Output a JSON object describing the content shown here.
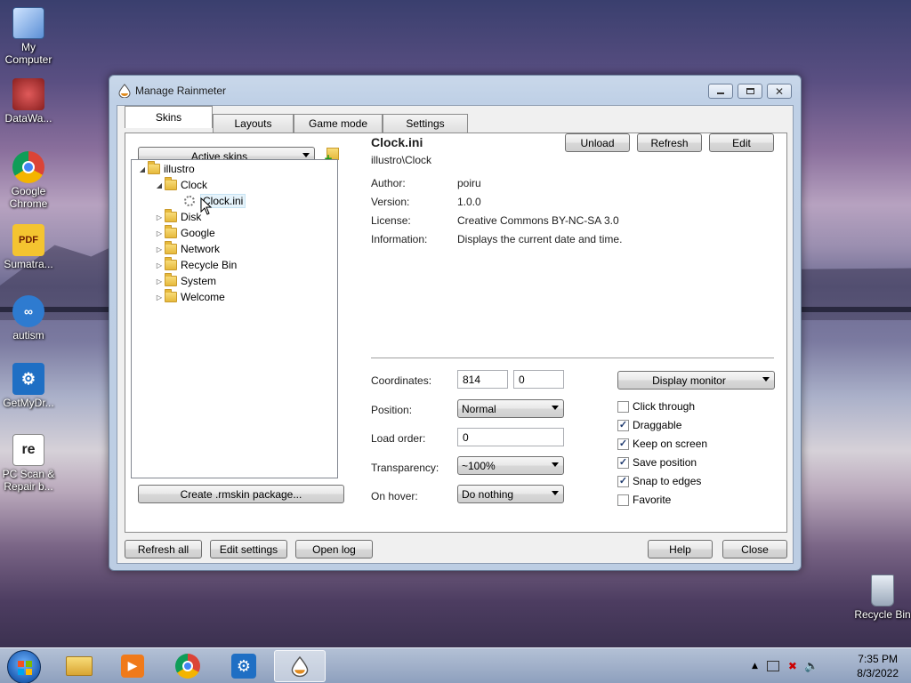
{
  "desktop": {
    "icons": [
      {
        "label": "My Computer",
        "icon": "computer-icon"
      },
      {
        "label": "DataWa...",
        "icon": "app-shortcut-icon"
      },
      {
        "label": "Google Chrome",
        "icon": "chrome-icon"
      },
      {
        "label": "Sumatra...",
        "icon": "pdf-icon"
      },
      {
        "label": "autism",
        "icon": "app-shortcut-icon"
      },
      {
        "label": "GetMyDr...",
        "icon": "gear-app-icon"
      },
      {
        "label": "PC Scan & Repair b...",
        "icon": "repair-icon"
      },
      {
        "label": "Recycle Bin",
        "icon": "recycle-bin-icon"
      }
    ]
  },
  "window": {
    "title": "Manage Rainmeter",
    "tabs": [
      {
        "label": "Skins",
        "active": true
      },
      {
        "label": "Layouts",
        "active": false
      },
      {
        "label": "Game mode",
        "active": false
      },
      {
        "label": "Settings",
        "active": false
      }
    ],
    "skins": {
      "active_skins_label": "Active skins",
      "tree": {
        "root": "illustro",
        "folders": [
          "Clock",
          "Disk",
          "Google",
          "Network",
          "Recycle Bin",
          "System",
          "Welcome"
        ],
        "clock_child": "Clock.ini"
      },
      "create_package_label": "Create .rmskin package...",
      "detail": {
        "name": "Clock.ini",
        "path": "illustro\\Clock",
        "buttons": {
          "unload": "Unload",
          "refresh": "Refresh",
          "edit": "Edit"
        },
        "info": [
          {
            "key": "Author:",
            "value": "poiru"
          },
          {
            "key": "Version:",
            "value": "1.0.0"
          },
          {
            "key": "License:",
            "value": "Creative Commons BY-NC-SA 3.0"
          },
          {
            "key": "Information:",
            "value": "Displays the current date and time."
          }
        ]
      },
      "settings": {
        "coordinates_label": "Coordinates:",
        "coord_x": "814",
        "coord_y": "0",
        "position_label": "Position:",
        "position_value": "Normal",
        "load_order_label": "Load order:",
        "load_order_value": "0",
        "transparency_label": "Transparency:",
        "transparency_value": "~100%",
        "on_hover_label": "On hover:",
        "on_hover_value": "Do nothing",
        "display_monitor_label": "Display monitor",
        "checkboxes": [
          {
            "label": "Click through",
            "checked": false
          },
          {
            "label": "Draggable",
            "checked": true
          },
          {
            "label": "Keep on screen",
            "checked": true
          },
          {
            "label": "Save position",
            "checked": true
          },
          {
            "label": "Snap to edges",
            "checked": true
          },
          {
            "label": "Favorite",
            "checked": false
          }
        ]
      }
    },
    "footer": {
      "refresh_all": "Refresh all",
      "edit_settings": "Edit settings",
      "open_log": "Open log",
      "help": "Help",
      "close": "Close"
    }
  },
  "taskbar": {
    "time": "7:35 PM",
    "date": "8/3/2022"
  }
}
